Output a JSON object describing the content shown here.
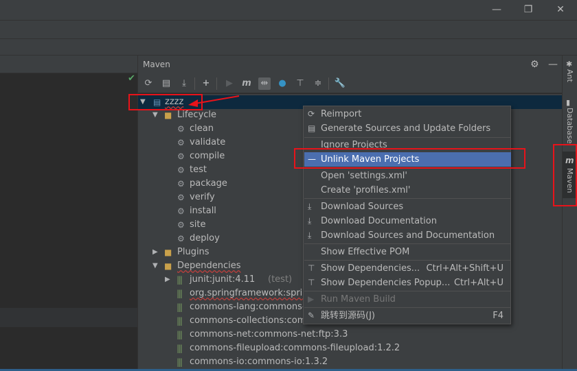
{
  "window": {
    "minimize_glyph": "—",
    "restore_glyph": "❐",
    "close_glyph": "✕"
  },
  "maven": {
    "title": "Maven",
    "settings_icon": "gear-icon",
    "hide_icon": "minus-icon",
    "toolbar": [
      "reimport-icon",
      "generate-sources-icon",
      "download-icon",
      "add-icon",
      "run-icon",
      "maven-m-icon",
      "toggle-offline-icon",
      "skip-tests-icon",
      "show-dependencies-icon",
      "collapse-icon",
      "settings-wrench-icon"
    ]
  },
  "tree": {
    "project": "zzzz",
    "lifecycle_label": "Lifecycle",
    "lifecycle": [
      "clean",
      "validate",
      "compile",
      "test",
      "package",
      "verify",
      "install",
      "site",
      "deploy"
    ],
    "plugins_label": "Plugins",
    "dependencies_label": "Dependencies",
    "dependencies": [
      {
        "name": "junit:junit:4.11",
        "scope": "(test)"
      },
      {
        "name": "org.springframework:spring",
        "scope": ""
      },
      {
        "name": "commons-lang:commons-lar",
        "scope": ""
      },
      {
        "name": "commons-collections:commc",
        "scope": ""
      },
      {
        "name": "commons-net:commons-net:ftp:3.3",
        "scope": ""
      },
      {
        "name": "commons-fileupload:commons-fileupload:1.2.2",
        "scope": ""
      },
      {
        "name": "commons-io:commons-io:1.3.2",
        "scope": ""
      }
    ]
  },
  "menu": {
    "reimport": "Reimport",
    "generate": "Generate Sources and Update Folders",
    "ignore": "Ignore Projects",
    "unlink": "Unlink Maven Projects",
    "open_settings": "Open 'settings.xml'",
    "create_profiles": "Create 'profiles.xml'",
    "download_sources": "Download Sources",
    "download_docs": "Download Documentation",
    "download_both": "Download Sources and Documentation",
    "effective_pom": "Show Effective POM",
    "show_deps": "Show Dependencies...",
    "show_deps_key": "Ctrl+Alt+Shift+U",
    "show_deps_popup": "Show Dependencies Popup...",
    "show_deps_popup_key": "Ctrl+Alt+U",
    "run_build": "Run Maven Build",
    "jump_source": "跳转到源码(J)",
    "jump_key": "F4"
  },
  "right_strip": {
    "ant": "Ant",
    "database": "Database",
    "maven": "Maven"
  },
  "colors": {
    "selection": "#4b6eaf",
    "annotation": "#e8131a",
    "ok": "#59a869"
  }
}
